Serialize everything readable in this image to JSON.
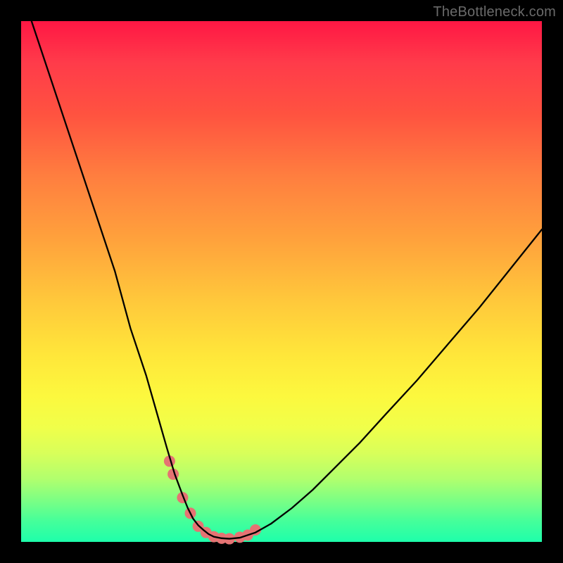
{
  "watermark": "TheBottleneck.com",
  "chart_data": {
    "type": "line",
    "title": "",
    "xlabel": "",
    "ylabel": "",
    "xlim": [
      0,
      100
    ],
    "ylim": [
      0,
      100
    ],
    "curve": {
      "name": "bottleneck-curve",
      "x": [
        2,
        6,
        10,
        14,
        18,
        21,
        24,
        26,
        28,
        29.5,
        31,
        32,
        33,
        34,
        35,
        36,
        37,
        38.5,
        40,
        42,
        45,
        48,
        52,
        56,
        60,
        65,
        70,
        76,
        82,
        88,
        94,
        100
      ],
      "y": [
        100,
        88,
        76,
        64,
        52,
        41,
        32,
        25,
        18,
        13,
        9,
        6.5,
        4.5,
        3.2,
        2.3,
        1.5,
        1,
        0.7,
        0.6,
        0.8,
        1.8,
        3.5,
        6.5,
        10,
        14,
        19,
        24.5,
        31,
        38,
        45,
        52.5,
        60
      ],
      "color": "#000000",
      "width": 2.3
    },
    "markers": {
      "name": "highlight-points",
      "x": [
        28.5,
        29.2,
        31,
        32.5,
        34,
        35.5,
        37,
        38.5,
        40,
        42,
        43.5,
        45
      ],
      "y": [
        15.5,
        13,
        8.5,
        5.5,
        3,
        1.8,
        1,
        0.7,
        0.6,
        0.9,
        1.3,
        2.3
      ],
      "color": "#e57373",
      "radius": 8
    },
    "gradient_meaning": "top (red) = 100% bottleneck, bottom (green) = 0% bottleneck"
  }
}
